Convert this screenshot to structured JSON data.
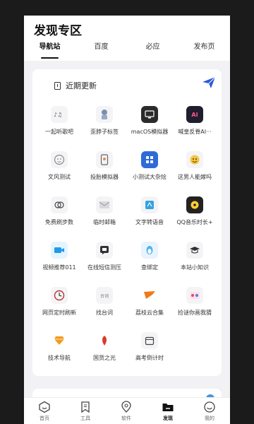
{
  "header": {
    "title": "发现专区",
    "tabs": [
      {
        "label": "导航站",
        "active": true
      },
      {
        "label": "百度",
        "active": false
      },
      {
        "label": "必应",
        "active": false
      },
      {
        "label": "发布页",
        "active": false
      }
    ]
  },
  "card": {
    "title": "近期更新",
    "apps": [
      {
        "label": "一起听歌吧",
        "icon": "music-note-icon"
      },
      {
        "label": "歪脖子标签",
        "icon": "robot-icon"
      },
      {
        "label": "macOS模拟器",
        "icon": "monitor-icon"
      },
      {
        "label": "喊皇反脊AI···",
        "icon": "ai-badge-icon"
      },
      {
        "label": "文风测试",
        "icon": "face-icon"
      },
      {
        "label": "投胎模拟器",
        "icon": "phone-icon"
      },
      {
        "label": "小测试大杂烩",
        "icon": "grid-icon"
      },
      {
        "label": "这男人能嫁吗",
        "icon": "emoji-icon"
      },
      {
        "label": "免费刷步数",
        "icon": "steps-icon"
      },
      {
        "label": "临时邮箱",
        "icon": "mail-icon"
      },
      {
        "label": "文字转语音",
        "icon": "translate-icon"
      },
      {
        "label": "QQ音乐时长+",
        "icon": "music-disc-icon"
      },
      {
        "label": "视频推荐011",
        "icon": "video-icon"
      },
      {
        "label": "在线短信测压",
        "icon": "sms-icon"
      },
      {
        "label": "查绑定",
        "icon": "qq-penguin-icon"
      },
      {
        "label": "本站小知识",
        "icon": "graduation-cap-icon"
      },
      {
        "label": "网页定时刷新",
        "icon": "timer-icon"
      },
      {
        "label": "找台词",
        "icon": "script-icon"
      },
      {
        "label": "荔枝云合集",
        "icon": "cloud-flag-icon"
      },
      {
        "label": "捡谜你画我猜",
        "icon": "paint-icon"
      },
      {
        "label": "技术导航",
        "icon": "diamond-icon"
      },
      {
        "label": "国货之光",
        "icon": "leaf-icon"
      },
      {
        "label": "高考倒计时",
        "icon": "calendar-icon"
      }
    ]
  },
  "icon_texts": {
    "ai": "AI",
    "script": "台词"
  },
  "bottom_nav": [
    {
      "label": "首页",
      "icon": "home-icon",
      "active": false
    },
    {
      "label": "工具",
      "icon": "bookmark-icon",
      "active": false
    },
    {
      "label": "软件",
      "icon": "location-icon",
      "active": false
    },
    {
      "label": "发现",
      "icon": "folder-icon",
      "active": true
    },
    {
      "label": "我的",
      "icon": "smile-icon",
      "active": false
    }
  ],
  "colors": {
    "accent": "#2b5bd9",
    "active_tab": "#111111"
  }
}
